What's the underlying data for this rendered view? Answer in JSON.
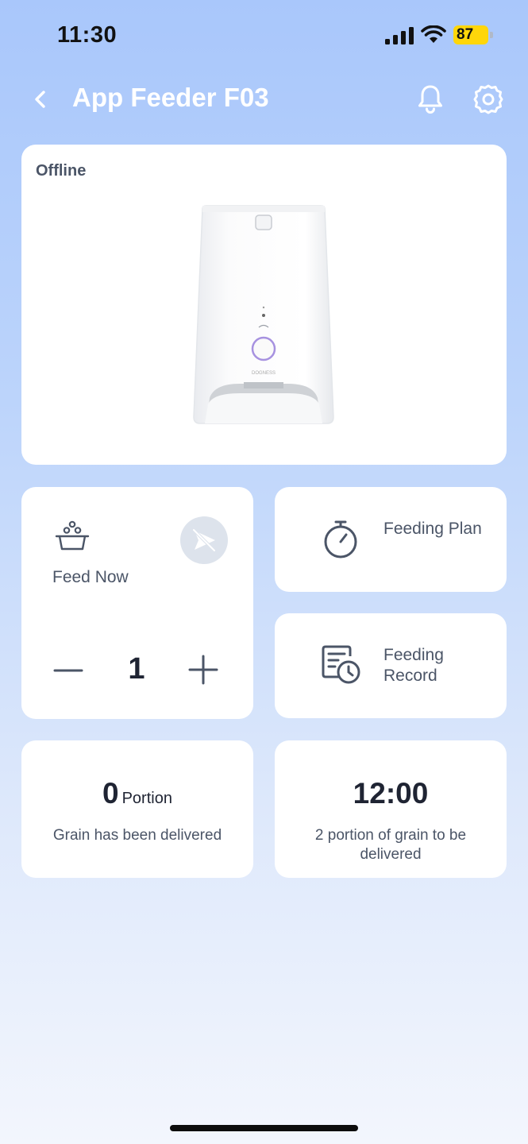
{
  "status_bar": {
    "time": "11:30",
    "battery": "87",
    "signal_icon": "cellular-signal-icon",
    "wifi_icon": "wifi-icon",
    "battery_color": "#ffd60a"
  },
  "header": {
    "back_icon": "chevron-left-icon",
    "title": "App Feeder F03",
    "bell_icon": "bell-icon",
    "settings_icon": "gear-icon"
  },
  "device": {
    "status": "Offline",
    "image": "pet-feeder-image"
  },
  "feed_now": {
    "label": "Feed Now",
    "icon": "food-bowl-icon",
    "send_icon": "send-disabled-icon",
    "portions": "1"
  },
  "tiles": {
    "plan_label": "Feeding Plan",
    "record_label": "Feeding Record"
  },
  "stats": {
    "delivered_count": "0",
    "delivered_unit": "Portion",
    "delivered_text": "Grain has been delivered",
    "next_time": "12:00",
    "next_text": "2 portion of grain to be delivered"
  },
  "colors": {
    "background_top": "#a9c7fb",
    "card": "#ffffff",
    "text_primary": "#1f2433",
    "text_secondary": "#4b5567"
  }
}
